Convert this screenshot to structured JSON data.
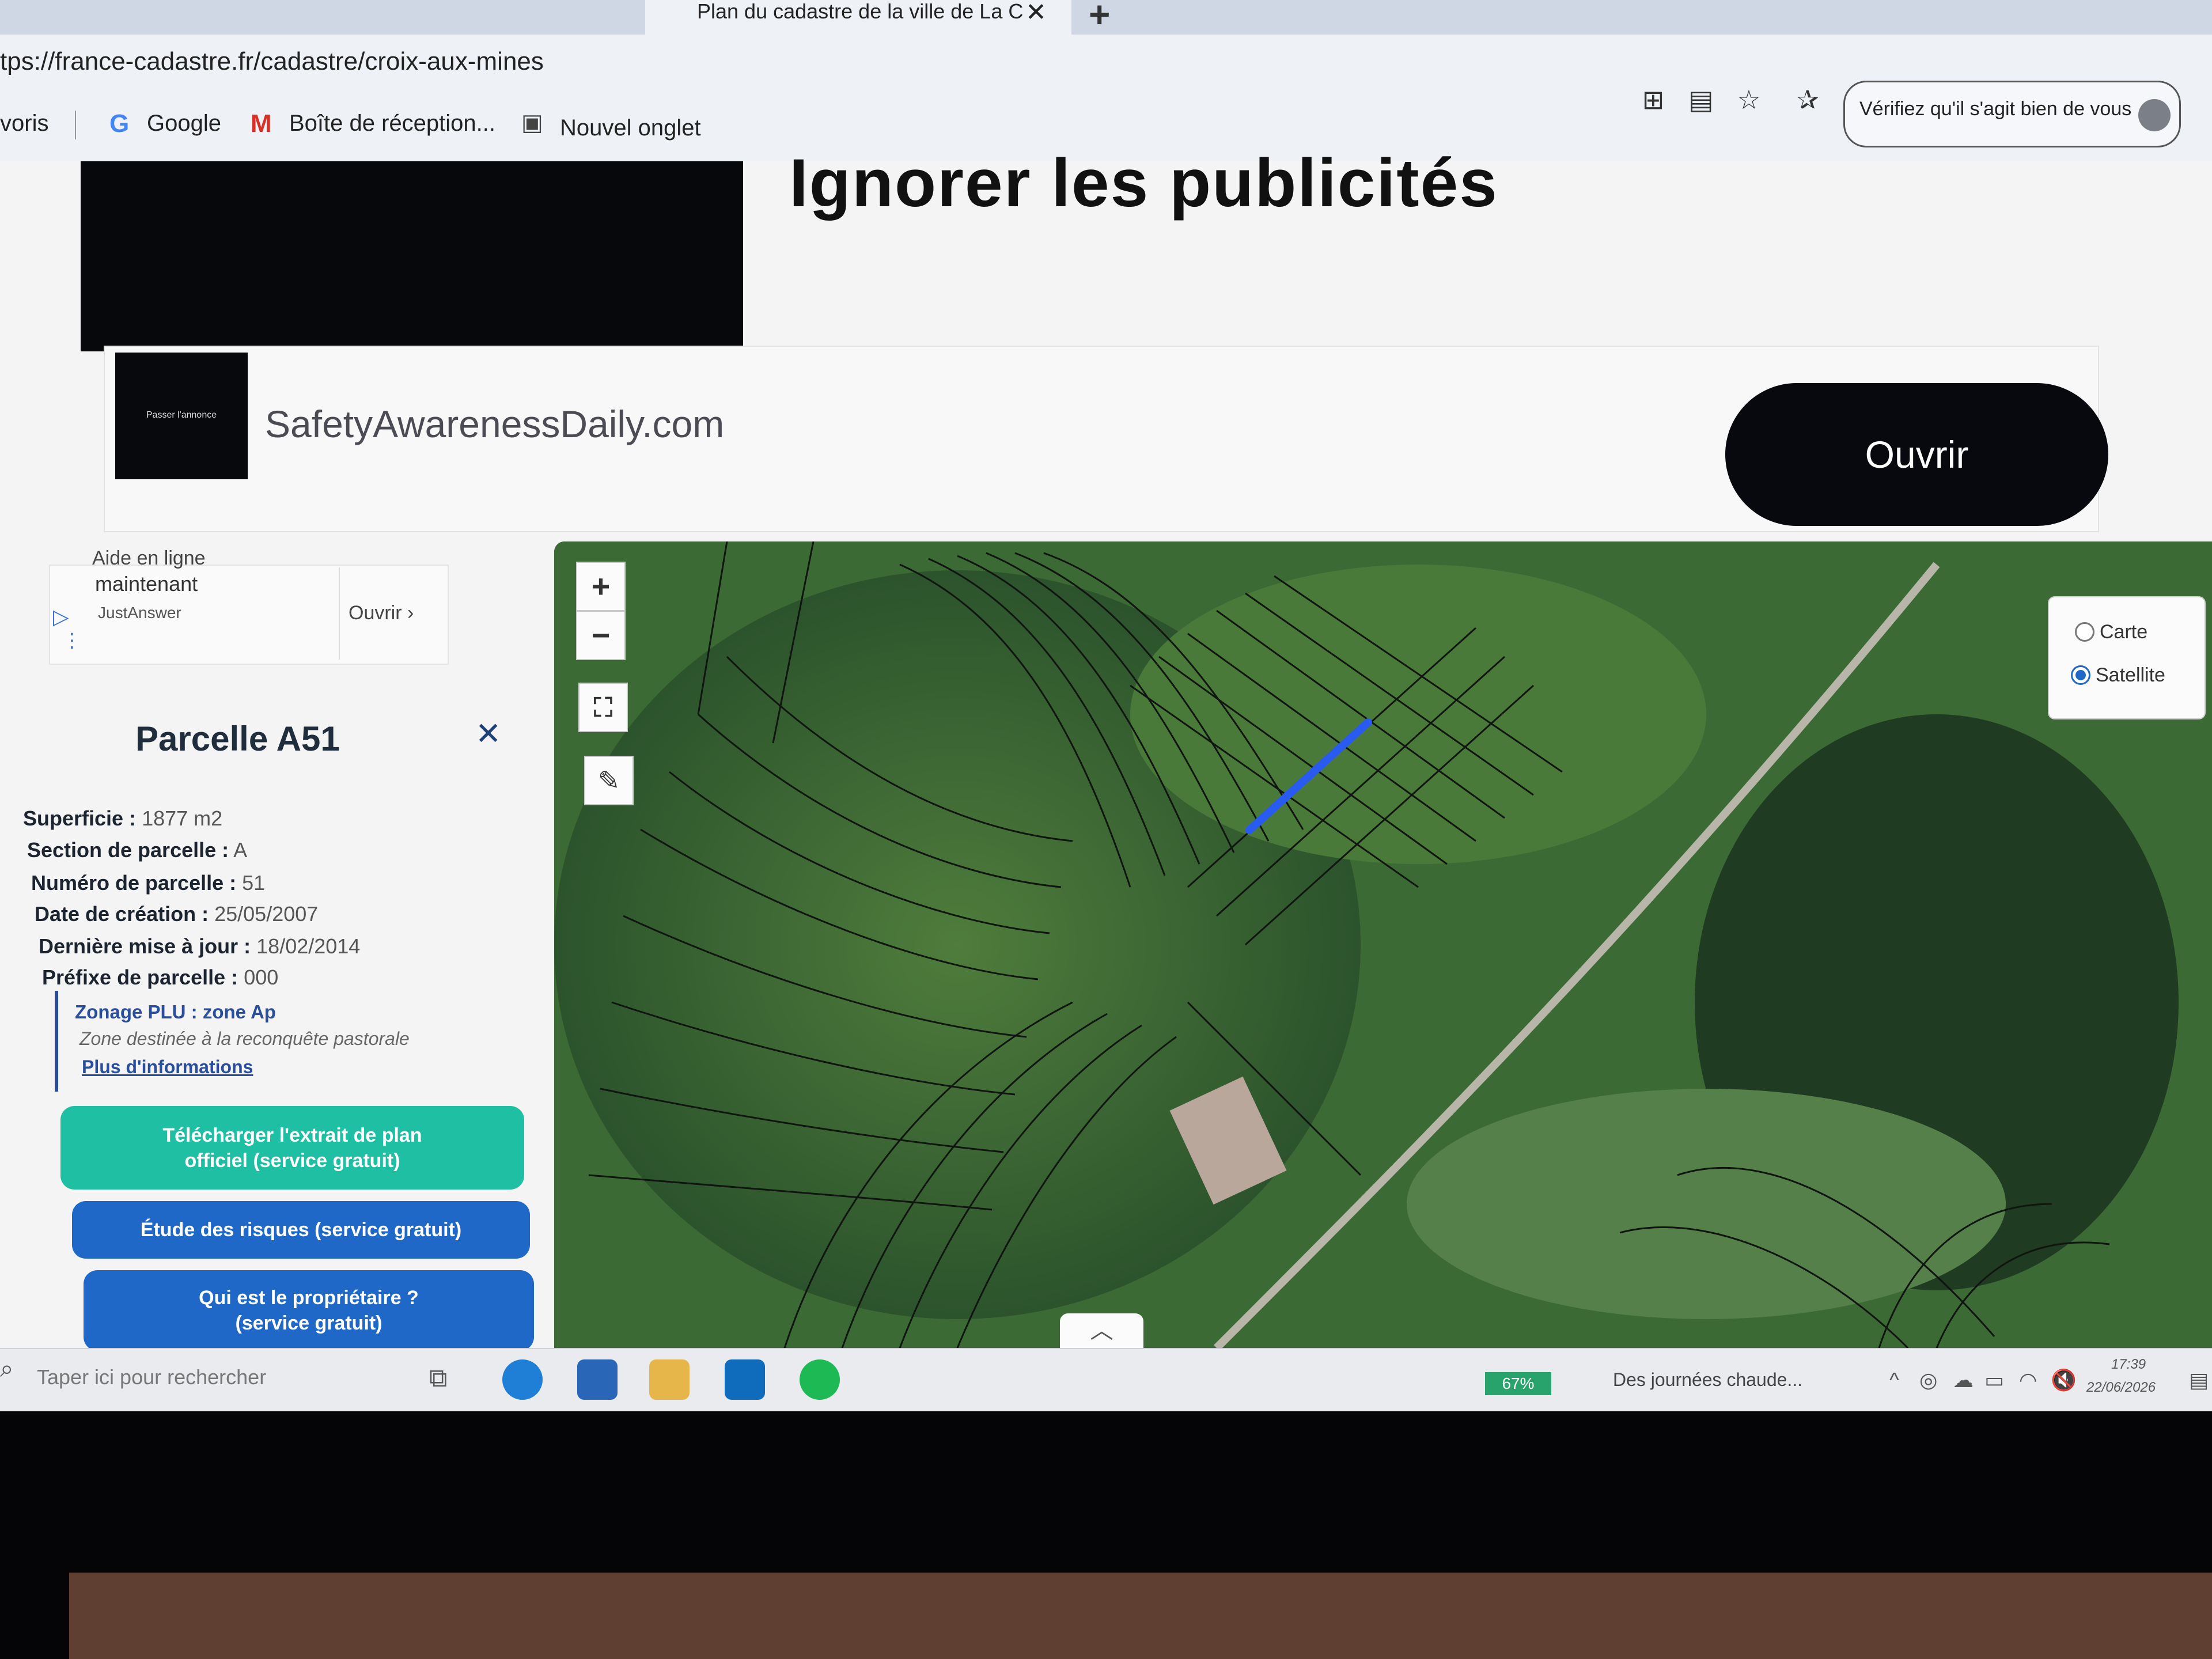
{
  "browser": {
    "tab_title": "Plan du cadastre de la ville de La C",
    "url": "tps://france-cadastre.fr/cadastre/croix-aux-mines",
    "bookmarks": [
      "voris",
      "Google",
      "Boîte de réception...",
      "Nouvel onglet"
    ],
    "verify_button": "Vérifiez qu'il s'agit bien de vous"
  },
  "ad": {
    "headline": "Ignorer les publicités",
    "logo_text": "Passer l'annonce",
    "domain": "SafetyAwarenessDaily.com",
    "open_button": "Ouvrir"
  },
  "small_ad": {
    "title_line1": "Aide en ligne",
    "title_line2": "maintenant",
    "brand": "JustAnswer",
    "open": "Ouvrir"
  },
  "parcel": {
    "title": "Parcelle A51",
    "fields": [
      {
        "label": "Superficie :",
        "value": "1877 m2"
      },
      {
        "label": "Section de parcelle :",
        "value": "A"
      },
      {
        "label": "Numéro de parcelle :",
        "value": "51"
      },
      {
        "label": "Date de création :",
        "value": "25/05/2007"
      },
      {
        "label": "Dernière mise à jour :",
        "value": "18/02/2014"
      },
      {
        "label": "Préfixe de parcelle :",
        "value": "000"
      }
    ],
    "zone_title": "Zonage PLU : zone Ap",
    "zone_desc": "Zone destinée à la reconquête pastorale",
    "zone_link": "Plus d'informations",
    "buttons": {
      "download": "Télécharger l'extrait de plan officiel (service gratuit)",
      "risk": "Étude des risques (service gratuit)",
      "owner": "Qui est le propriétaire ? (service gratuit)"
    }
  },
  "map": {
    "zoom_in": "+",
    "zoom_out": "−",
    "layer_carte": "Carte",
    "layer_satellite": "Satellite",
    "selected_layer": "Satellite",
    "highlight_color": "#2a5bf0"
  },
  "taskbar": {
    "search_placeholder": "Taper ici pour rechercher",
    "battery": "67%",
    "weather": "Des journées chaude...",
    "time": "17:39",
    "date": "22/06/2026"
  }
}
